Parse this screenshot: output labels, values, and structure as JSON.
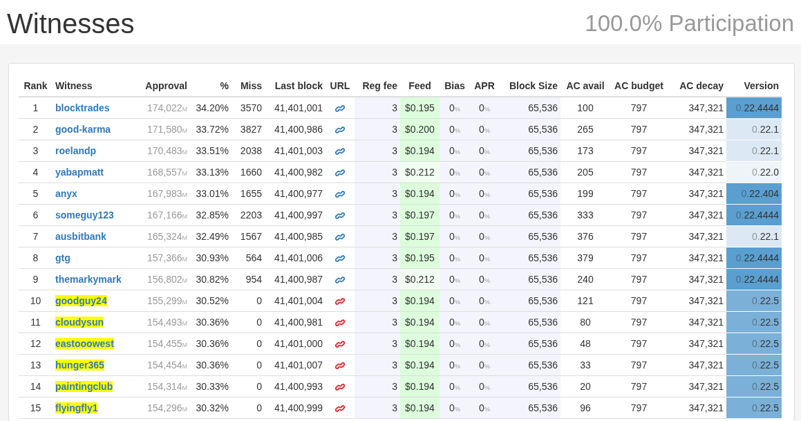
{
  "title": "Witnesses",
  "participation": "100.0% Participation",
  "columns": [
    "Rank",
    "Witness",
    "Approval",
    "%",
    "Miss",
    "Last block",
    "URL",
    "Reg fee",
    "Feed",
    "Bias",
    "APR",
    "Block Size",
    "AC avail",
    "AC budget",
    "AC decay",
    "Version"
  ],
  "rows": [
    {
      "rank": "1",
      "witness": "blocktrades",
      "highlighted": false,
      "approval": "174,022",
      "approval_unit": "M",
      "percent": "34.20%",
      "miss": "3570",
      "last_block": "41,401,001",
      "url": {
        "color": "#337ab7"
      },
      "reg_fee": "3",
      "feed": "$0.195",
      "feed_fresh": true,
      "bias": "0",
      "bias_unit": "%",
      "apr": "0",
      "apr_unit": "%",
      "block_size": "65,536",
      "ac_avail": "100",
      "ac_budget": "797",
      "ac_decay": "347,321",
      "version": {
        "text": "0.22.4444",
        "color": "#5a9fd0"
      }
    },
    {
      "rank": "2",
      "witness": "good-karma",
      "highlighted": false,
      "approval": "171,580",
      "approval_unit": "M",
      "percent": "33.72%",
      "miss": "3827",
      "last_block": "41,400,986",
      "url": {
        "color": "#337ab7"
      },
      "reg_fee": "3",
      "feed": "$0.200",
      "feed_fresh": true,
      "bias": "0",
      "bias_unit": "%",
      "apr": "0",
      "apr_unit": "%",
      "block_size": "65,536",
      "ac_avail": "265",
      "ac_budget": "797",
      "ac_decay": "347,321",
      "version": {
        "text": "0.22.1",
        "color": "#dce9f4"
      }
    },
    {
      "rank": "3",
      "witness": "roelandp",
      "highlighted": false,
      "approval": "170,483",
      "approval_unit": "M",
      "percent": "33.51%",
      "miss": "2038",
      "last_block": "41,401,003",
      "url": {
        "color": "#337ab7"
      },
      "reg_fee": "3",
      "feed": "$0.194",
      "feed_fresh": true,
      "bias": "0",
      "bias_unit": "%",
      "apr": "0",
      "apr_unit": "%",
      "block_size": "65,536",
      "ac_avail": "173",
      "ac_budget": "797",
      "ac_decay": "347,321",
      "version": {
        "text": "0.22.1",
        "color": "#dce9f4"
      }
    },
    {
      "rank": "4",
      "witness": "yabapmatt",
      "highlighted": false,
      "approval": "168,557",
      "approval_unit": "M",
      "percent": "33.13%",
      "miss": "1660",
      "last_block": "41,400,982",
      "url": {
        "color": "#337ab7"
      },
      "reg_fee": "3",
      "feed": "$0.212",
      "feed_fresh": false,
      "bias": "0",
      "bias_unit": "%",
      "apr": "0",
      "apr_unit": "%",
      "block_size": "65,536",
      "ac_avail": "205",
      "ac_budget": "797",
      "ac_decay": "347,321",
      "version": {
        "text": "0.22.0",
        "color": "#eef4f8"
      }
    },
    {
      "rank": "5",
      "witness": "anyx",
      "highlighted": false,
      "approval": "167,983",
      "approval_unit": "M",
      "percent": "33.01%",
      "miss": "1655",
      "last_block": "41,400,977",
      "url": {
        "color": "#337ab7"
      },
      "reg_fee": "3",
      "feed": "$0.194",
      "feed_fresh": true,
      "bias": "0",
      "bias_unit": "%",
      "apr": "0",
      "apr_unit": "%",
      "block_size": "65,536",
      "ac_avail": "199",
      "ac_budget": "797",
      "ac_decay": "347,321",
      "version": {
        "text": "0.22.404",
        "color": "#5a9fd0"
      }
    },
    {
      "rank": "6",
      "witness": "someguy123",
      "highlighted": false,
      "approval": "167,166",
      "approval_unit": "M",
      "percent": "32.85%",
      "miss": "2203",
      "last_block": "41,400,997",
      "url": {
        "color": "#337ab7"
      },
      "reg_fee": "3",
      "feed": "$0.197",
      "feed_fresh": true,
      "bias": "0",
      "bias_unit": "%",
      "apr": "0",
      "apr_unit": "%",
      "block_size": "65,536",
      "ac_avail": "333",
      "ac_budget": "797",
      "ac_decay": "347,321",
      "version": {
        "text": "0.22.4444",
        "color": "#5a9fd0"
      }
    },
    {
      "rank": "7",
      "witness": "ausbitbank",
      "highlighted": false,
      "approval": "165,324",
      "approval_unit": "M",
      "percent": "32.49%",
      "miss": "1567",
      "last_block": "41,400,985",
      "url": {
        "color": "#337ab7"
      },
      "reg_fee": "3",
      "feed": "$0.197",
      "feed_fresh": true,
      "bias": "0",
      "bias_unit": "%",
      "apr": "0",
      "apr_unit": "%",
      "block_size": "65,536",
      "ac_avail": "376",
      "ac_budget": "797",
      "ac_decay": "347,321",
      "version": {
        "text": "0.22.1",
        "color": "#dce9f4"
      }
    },
    {
      "rank": "8",
      "witness": "gtg",
      "highlighted": false,
      "approval": "157,366",
      "approval_unit": "M",
      "percent": "30.93%",
      "miss": "564",
      "last_block": "41,401,006",
      "url": {
        "color": "#337ab7"
      },
      "reg_fee": "3",
      "feed": "$0.195",
      "feed_fresh": true,
      "bias": "0",
      "bias_unit": "%",
      "apr": "0",
      "apr_unit": "%",
      "block_size": "65,536",
      "ac_avail": "379",
      "ac_budget": "797",
      "ac_decay": "347,321",
      "version": {
        "text": "0.22.4444",
        "color": "#5a9fd0"
      }
    },
    {
      "rank": "9",
      "witness": "themarkymark",
      "highlighted": false,
      "approval": "156,802",
      "approval_unit": "M",
      "percent": "30.82%",
      "miss": "954",
      "last_block": "41,400,987",
      "url": {
        "color": "#337ab7"
      },
      "reg_fee": "3",
      "feed": "$0.212",
      "feed_fresh": false,
      "bias": "0",
      "bias_unit": "%",
      "apr": "0",
      "apr_unit": "%",
      "block_size": "65,536",
      "ac_avail": "240",
      "ac_budget": "797",
      "ac_decay": "347,321",
      "version": {
        "text": "0.22.4444",
        "color": "#5a9fd0"
      }
    },
    {
      "rank": "10",
      "witness": "goodguy24",
      "highlighted": true,
      "approval": "155,299",
      "approval_unit": "M",
      "percent": "30.52%",
      "miss": "0",
      "last_block": "41,401,004",
      "url": {
        "color": "#e8202a"
      },
      "reg_fee": "3",
      "feed": "$0.194",
      "feed_fresh": true,
      "bias": "0",
      "bias_unit": "%",
      "apr": "0",
      "apr_unit": "%",
      "block_size": "65,536",
      "ac_avail": "121",
      "ac_budget": "797",
      "ac_decay": "347,321",
      "version": {
        "text": "0.22.5",
        "color": "#7bb0d8"
      }
    },
    {
      "rank": "11",
      "witness": "cloudysun",
      "highlighted": true,
      "approval": "154,493",
      "approval_unit": "M",
      "percent": "30.36%",
      "miss": "0",
      "last_block": "41,400,981",
      "url": {
        "color": "#e8202a"
      },
      "reg_fee": "3",
      "feed": "$0.194",
      "feed_fresh": true,
      "bias": "0",
      "bias_unit": "%",
      "apr": "0",
      "apr_unit": "%",
      "block_size": "65,536",
      "ac_avail": "80",
      "ac_budget": "797",
      "ac_decay": "347,321",
      "version": {
        "text": "0.22.5",
        "color": "#7bb0d8"
      }
    },
    {
      "rank": "12",
      "witness": "eastooowest",
      "highlighted": true,
      "approval": "154,455",
      "approval_unit": "M",
      "percent": "30.36%",
      "miss": "0",
      "last_block": "41,401,000",
      "url": {
        "color": "#e8202a"
      },
      "reg_fee": "3",
      "feed": "$0.194",
      "feed_fresh": true,
      "bias": "0",
      "bias_unit": "%",
      "apr": "0",
      "apr_unit": "%",
      "block_size": "65,536",
      "ac_avail": "48",
      "ac_budget": "797",
      "ac_decay": "347,321",
      "version": {
        "text": "0.22.5",
        "color": "#7bb0d8"
      }
    },
    {
      "rank": "13",
      "witness": "hunger365",
      "highlighted": true,
      "approval": "154,454",
      "approval_unit": "M",
      "percent": "30.36%",
      "miss": "0",
      "last_block": "41,401,007",
      "url": {
        "color": "#e8202a"
      },
      "reg_fee": "3",
      "feed": "$0.194",
      "feed_fresh": true,
      "bias": "0",
      "bias_unit": "%",
      "apr": "0",
      "apr_unit": "%",
      "block_size": "65,536",
      "ac_avail": "33",
      "ac_budget": "797",
      "ac_decay": "347,321",
      "version": {
        "text": "0.22.5",
        "color": "#7bb0d8"
      }
    },
    {
      "rank": "14",
      "witness": "paintingclub",
      "highlighted": true,
      "approval": "154,314",
      "approval_unit": "M",
      "percent": "30.33%",
      "miss": "0",
      "last_block": "41,400,993",
      "url": {
        "color": "#e8202a"
      },
      "reg_fee": "3",
      "feed": "$0.194",
      "feed_fresh": true,
      "bias": "0",
      "bias_unit": "%",
      "apr": "0",
      "apr_unit": "%",
      "block_size": "65,536",
      "ac_avail": "20",
      "ac_budget": "797",
      "ac_decay": "347,321",
      "version": {
        "text": "0.22.5",
        "color": "#7bb0d8"
      }
    },
    {
      "rank": "15",
      "witness": "flyingfly1",
      "highlighted": true,
      "approval": "154,296",
      "approval_unit": "M",
      "percent": "30.32%",
      "miss": "0",
      "last_block": "41,400,999",
      "url": {
        "color": "#e8202a"
      },
      "reg_fee": "3",
      "feed": "$0.194",
      "feed_fresh": true,
      "bias": "0",
      "bias_unit": "%",
      "apr": "0",
      "apr_unit": "%",
      "block_size": "65,536",
      "ac_avail": "96",
      "ac_budget": "797",
      "ac_decay": "347,321",
      "version": {
        "text": "0.22.5",
        "color": "#7bb0d8"
      }
    }
  ]
}
